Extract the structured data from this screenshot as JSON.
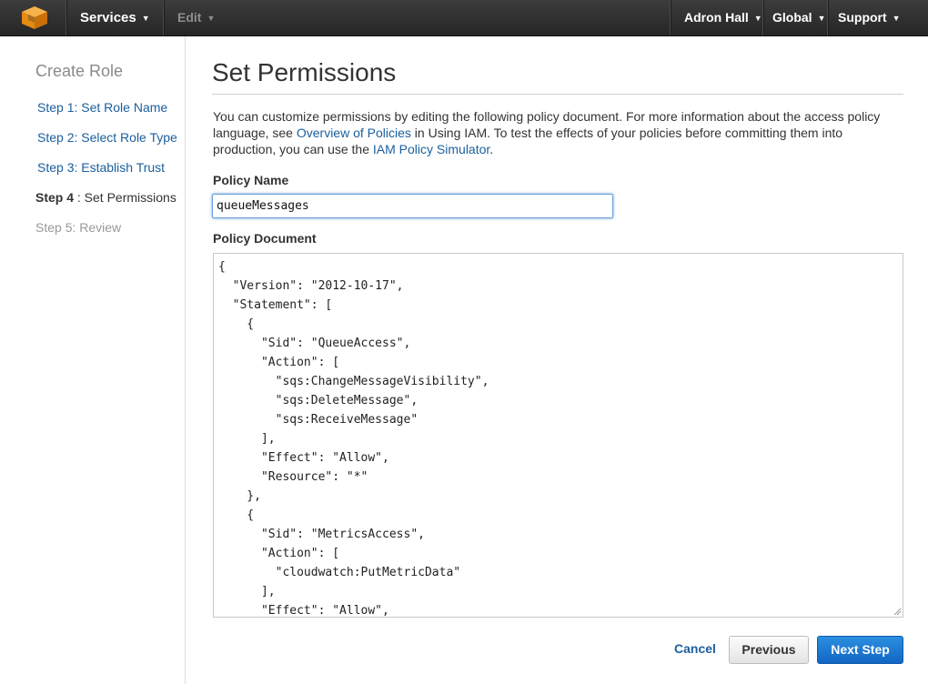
{
  "header": {
    "services_label": "Services",
    "edit_label": "Edit",
    "user_label": "Adron Hall",
    "region_label": "Global",
    "support_label": "Support",
    "logo_icon": "aws-cube-icon",
    "accent": "#f7981d"
  },
  "sidebar": {
    "title": "Create Role",
    "steps": [
      {
        "label": "Step 1: Set Role Name"
      },
      {
        "label": "Step 2: Select Role Type"
      },
      {
        "label": "Step 3: Establish Trust"
      },
      {
        "prefix": "Step 4",
        "label": " : Set Permissions"
      },
      {
        "label": "Step 5: Review"
      }
    ]
  },
  "main": {
    "title": "Set Permissions",
    "description": {
      "part1": "You can customize permissions by editing the following policy document. For more information about the access policy language, see ",
      "link1": "Overview of Policies",
      "part2": " in Using IAM. To test the effects of your policies before committing them into production, you can use the ",
      "link2": "IAM Policy Simulator",
      "part3": "."
    },
    "policy_name_label": "Policy Name",
    "policy_name_value": "queueMessages",
    "policy_document_label": "Policy Document",
    "policy_document": "{\n  \"Version\": \"2012-10-17\",\n  \"Statement\": [\n    {\n      \"Sid\": \"QueueAccess\",\n      \"Action\": [\n        \"sqs:ChangeMessageVisibility\",\n        \"sqs:DeleteMessage\",\n        \"sqs:ReceiveMessage\"\n      ],\n      \"Effect\": \"Allow\",\n      \"Resource\": \"*\"\n    },\n    {\n      \"Sid\": \"MetricsAccess\",\n      \"Action\": [\n        \"cloudwatch:PutMetricData\"\n      ],\n      \"Effect\": \"Allow\","
  },
  "actions": {
    "cancel": "Cancel",
    "previous": "Previous",
    "next": "Next Step"
  }
}
